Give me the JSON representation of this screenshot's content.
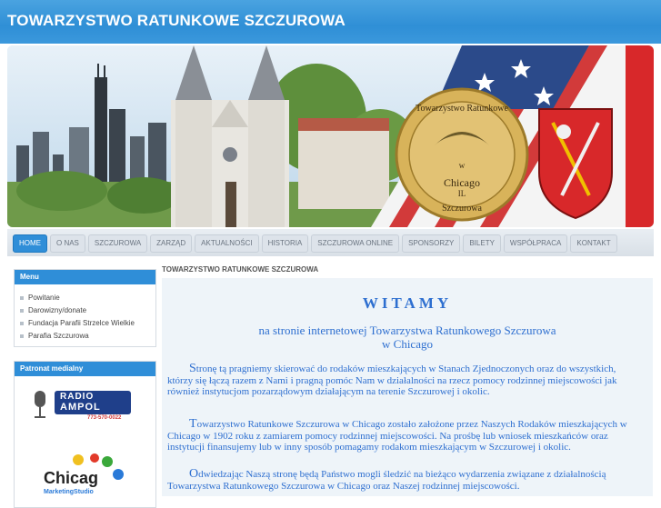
{
  "header": {
    "title": "TOWARZYSTWO RATUNKOWE SZCZUROWA"
  },
  "banner": {
    "seal_lines": [
      "Towarzystwo Ratunkowe",
      "w",
      "Chicago",
      "IL",
      "Szczurowa"
    ],
    "colors": {
      "sky": "#cfe3f2",
      "gold": "#d8b35a",
      "coat_red": "#d8282a"
    }
  },
  "nav": {
    "items": [
      "HOME",
      "O NAS",
      "SZCZUROWA",
      "ZARZĄD",
      "AKTUALNOŚCI",
      "HISTORIA",
      "SZCZUROWA ONLINE",
      "SPONSORZY",
      "BILETY",
      "WSPÓŁPRACA",
      "KONTAKT"
    ],
    "active_index": 0
  },
  "sidebar": {
    "menu_title": "Menu",
    "menu_items": [
      "Powitanie",
      "Darowizny/donate",
      "Fundacja Parafii Strzelce Wielkie",
      "Parafia Szczurowa"
    ],
    "patronat_title": "Patronat medialny",
    "radio_logo": {
      "line1": "RADIO",
      "line2": "AMPOL",
      "phone": "773-570-0022"
    },
    "chicago_logo": {
      "text": "Chicag",
      "sub": "MarketingStudio"
    }
  },
  "main": {
    "breadcrumb": "TOWARZYSTWO RATUNKOWE SZCZUROWA",
    "welcome": "WITAMY",
    "subtitle1": "na stronie internetowej Towarzystwa Ratunkowego Szczurowa",
    "subtitle2": "w Chicago",
    "paragraphs": [
      {
        "cap": "S",
        "text": "tronę tą pragniemy skierować do rodaków mieszkających w Stanach Zjednoczonych oraz do wszystkich, którzy się łączą razem z Nami i pragną pomóc Nam w działalności na rzecz pomocy rodzinnej miejscowości jak również instytucjom pozarządowym działającym na terenie Szczurowej i okolic."
      },
      {
        "cap": "T",
        "text": "owarzystwo Ratunkowe Szczurowa w Chicago zostało założone przez Naszych Rodaków mieszkających w Chicago w 1902 roku z zamiarem pomocy rodzinnej miejscowości. Na prośbę lub wniosek mieszkańców oraz instytucji finansujemy lub w inny sposób pomagamy rodakom mieszkającym w Szczurowej i okolic."
      },
      {
        "cap": "O",
        "text": "dwiedzając Naszą stronę będą Państwo mogli śledzić na bieżąco wydarzenia związane z działalnością Towarzystwa Ratunkowego Szczurowa w Chicago oraz Naszej rodzinnej miejscowości."
      }
    ]
  }
}
